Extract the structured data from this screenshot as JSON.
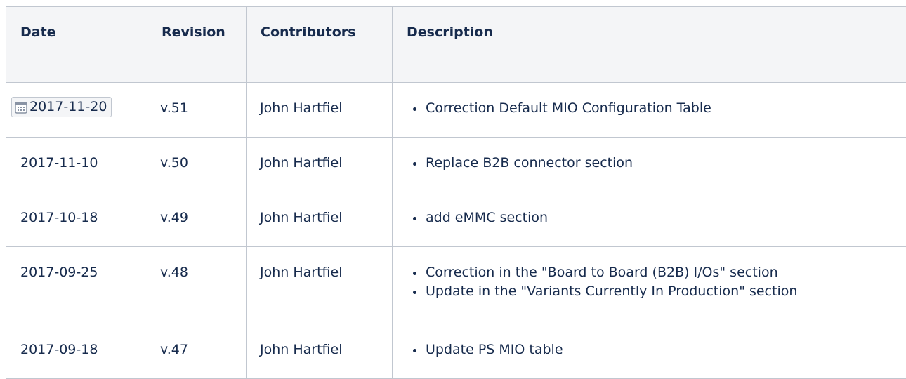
{
  "table": {
    "headers": [
      "Date",
      "Revision",
      "Contributors",
      "Description"
    ],
    "rows": [
      {
        "date": "2017-11-20",
        "date_has_calendar_chip": true,
        "revision": "v.51",
        "contributors": "John Hartfiel",
        "description": [
          "Correction Default MIO Configuration Table"
        ]
      },
      {
        "date": "2017-11-10",
        "revision": "v.50",
        "contributors": "John Hartfiel",
        "description": [
          "Replace B2B connector section"
        ]
      },
      {
        "date": "2017-10-18",
        "revision": "v.49",
        "contributors": "John Hartfiel",
        "description": [
          "add eMMC section"
        ]
      },
      {
        "date": "2017-09-25",
        "revision": "v.48",
        "contributors": "John Hartfiel",
        "description": [
          "Correction in the \"Board to Board (B2B) I/Os\" section",
          "Update in the \"Variants Currently In Production\" section"
        ]
      },
      {
        "date": "2017-09-18",
        "revision": "v.47",
        "contributors": "John Hartfiel",
        "description": [
          "Update PS MIO table"
        ]
      }
    ]
  },
  "icons": {
    "date_chip": "calendar-icon"
  },
  "colors": {
    "header_bg": "#f4f5f7",
    "border": "#c1c7d0",
    "text": "#172b4d",
    "icon": "#8993a4"
  }
}
